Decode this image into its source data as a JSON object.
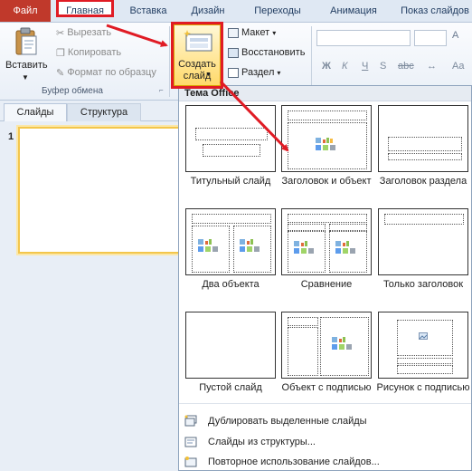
{
  "tabs": {
    "file": "Файл",
    "home": "Главная",
    "insert": "Вставка",
    "design": "Дизайн",
    "transitions": "Переходы",
    "animation": "Анимация",
    "slideshow": "Показ слайдов"
  },
  "clipboard": {
    "paste": "Вставить",
    "cut": "Вырезать",
    "copy": "Копировать",
    "format_painter": "Формат по образцу",
    "group_label": "Буфер обмена"
  },
  "slides_group": {
    "new_slide_line1": "Создать",
    "new_slide_line2": "слайд",
    "layout": "Макет",
    "reset": "Восстановить",
    "section": "Раздел"
  },
  "font_group": {
    "bold": "Ж",
    "italic": "К",
    "underline": "Ч",
    "strike": "abc"
  },
  "pane": {
    "tab_slides": "Слайды",
    "tab_outline": "Структура",
    "slide_number": "1"
  },
  "gallery": {
    "header": "Тема Office",
    "layouts": [
      {
        "label": "Титульный слайд"
      },
      {
        "label": "Заголовок и объект"
      },
      {
        "label": "Заголовок раздела"
      },
      {
        "label": "Два объекта"
      },
      {
        "label": "Сравнение"
      },
      {
        "label": "Только заголовок"
      },
      {
        "label": "Пустой слайд"
      },
      {
        "label": "Объект с подписью"
      },
      {
        "label": "Рисунок с подписью"
      }
    ],
    "commands": {
      "duplicate": "Дублировать выделенные слайды",
      "from_outline": "Слайды из структуры...",
      "reuse": "Повторное использование слайдов..."
    }
  },
  "colors": {
    "file_tab": "#c0392b",
    "highlight": "#e01b24",
    "new_slide_button": "#ffd96a",
    "selected_slide_border": "#f3c64c"
  }
}
